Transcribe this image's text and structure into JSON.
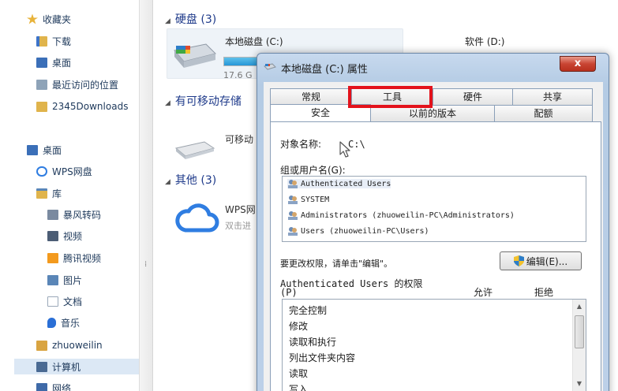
{
  "sidebar": {
    "items": [
      {
        "label": "收藏夹",
        "color": "#e8b33a"
      },
      {
        "label": "下载",
        "color": "#3d74c9"
      },
      {
        "label": "桌面",
        "color": "#3b6fb8"
      },
      {
        "label": "最近访问的位置",
        "color": "#8ea3b8"
      },
      {
        "label": "2345Downloads",
        "color": "#e0b44c"
      },
      {
        "label": "桌面",
        "color": "#3b6fb8"
      },
      {
        "label": "WPS网盘",
        "color": "#2f7de1"
      },
      {
        "label": "库",
        "color": "#e0b44c"
      },
      {
        "label": "暴风转码",
        "color": "#7a8aa0"
      },
      {
        "label": "视频",
        "color": "#4c5d75"
      },
      {
        "label": "腾讯视频",
        "color": "#f39a1e"
      },
      {
        "label": "图片",
        "color": "#5a86b7"
      },
      {
        "label": "文档",
        "color": "#9aa8b8"
      },
      {
        "label": "音乐",
        "color": "#2a6fd6"
      },
      {
        "label": "zhuoweilin",
        "color": "#d9a441"
      },
      {
        "label": "计算机",
        "color": "#4a6a93"
      },
      {
        "label": "网络",
        "color": "#3f6aa8"
      }
    ]
  },
  "content": {
    "group_disks": "硬盘 (3)",
    "group_removable": "有可移动存储",
    "group_other": "其他 (3)",
    "drive_c_name": "本地磁盘 (C:)",
    "drive_c_free": "17.6 G",
    "drive_c_fill_fraction": 0.42,
    "drive_d_name": "软件 (D:)",
    "removable_name": "可移动",
    "wps_name": "WPS网",
    "wps_sub": "双击进"
  },
  "dialog": {
    "title": "本地磁盘 (C:) 属性",
    "close_label": "x",
    "tabs_back": [
      "常规",
      "工具",
      "硬件",
      "共享"
    ],
    "tabs_front": [
      "安全",
      "以前的版本",
      "配额"
    ],
    "object_label": "对象名称:",
    "object_value": "C:\\",
    "group_label": "组或用户名(G):",
    "users": [
      "Authenticated Users",
      "SYSTEM",
      "Administrators (zhuoweilin-PC\\Administrators)",
      "Users (zhuoweilin-PC\\Users)"
    ],
    "change_hint": "要更改权限，请单击\"编辑\"。",
    "edit_button": "编辑(E)...",
    "perm_for": "Authenticated Users 的权限",
    "perm_p": "(P)",
    "col_allow": "允许",
    "col_deny": "拒绝",
    "permissions": [
      "完全控制",
      "修改",
      "读取和执行",
      "列出文件夹内容",
      "读取",
      "写入"
    ]
  },
  "colors": {
    "highlight": "#e3121b",
    "dialog_frame": "#bcd0e8",
    "close_button": "#c94533"
  }
}
